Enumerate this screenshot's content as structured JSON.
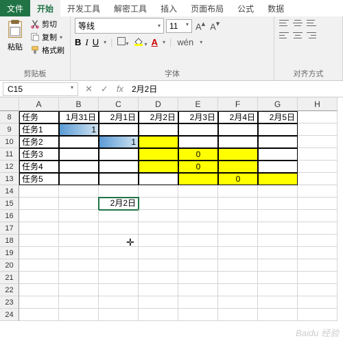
{
  "tabs": {
    "file": "文件",
    "home": "开始",
    "dev": "开发工具",
    "dec": "解密工具",
    "insert": "插入",
    "layout": "页面布局",
    "formula": "公式",
    "data": "数据"
  },
  "ribbon": {
    "clipboard": {
      "paste": "粘贴",
      "cut": "剪切",
      "copy": "复制",
      "brush": "格式刷",
      "label": "剪贴板"
    },
    "font": {
      "name": "等线",
      "size": "11",
      "label": "字体"
    },
    "align": {
      "label": "对齐方式"
    }
  },
  "namebox": "C15",
  "formula": "2月2日",
  "rows": [
    "8",
    "9",
    "10",
    "11",
    "12",
    "13",
    "14",
    "15",
    "16",
    "17",
    "18",
    "19",
    "20",
    "21",
    "22",
    "23",
    "24"
  ],
  "cols": [
    "A",
    "B",
    "C",
    "D",
    "E",
    "F",
    "G",
    "H"
  ],
  "table": {
    "h": [
      "任务",
      "1月31日",
      "2月1日",
      "2月2日",
      "2月3日",
      "2月4日",
      "2月5日"
    ],
    "r1": [
      "任务1",
      "1",
      "",
      "",
      "",
      "",
      ""
    ],
    "r2": [
      "任务2",
      "",
      "1",
      "",
      "",
      "",
      ""
    ],
    "r3": [
      "任务3",
      "",
      "",
      "",
      "0",
      "",
      ""
    ],
    "r4": [
      "任务4",
      "",
      "",
      "",
      "0",
      "",
      ""
    ],
    "r5": [
      "任务5",
      "",
      "",
      "",
      "",
      "0",
      ""
    ]
  },
  "c15": "2月2日",
  "watermark": "Baidu 经验"
}
